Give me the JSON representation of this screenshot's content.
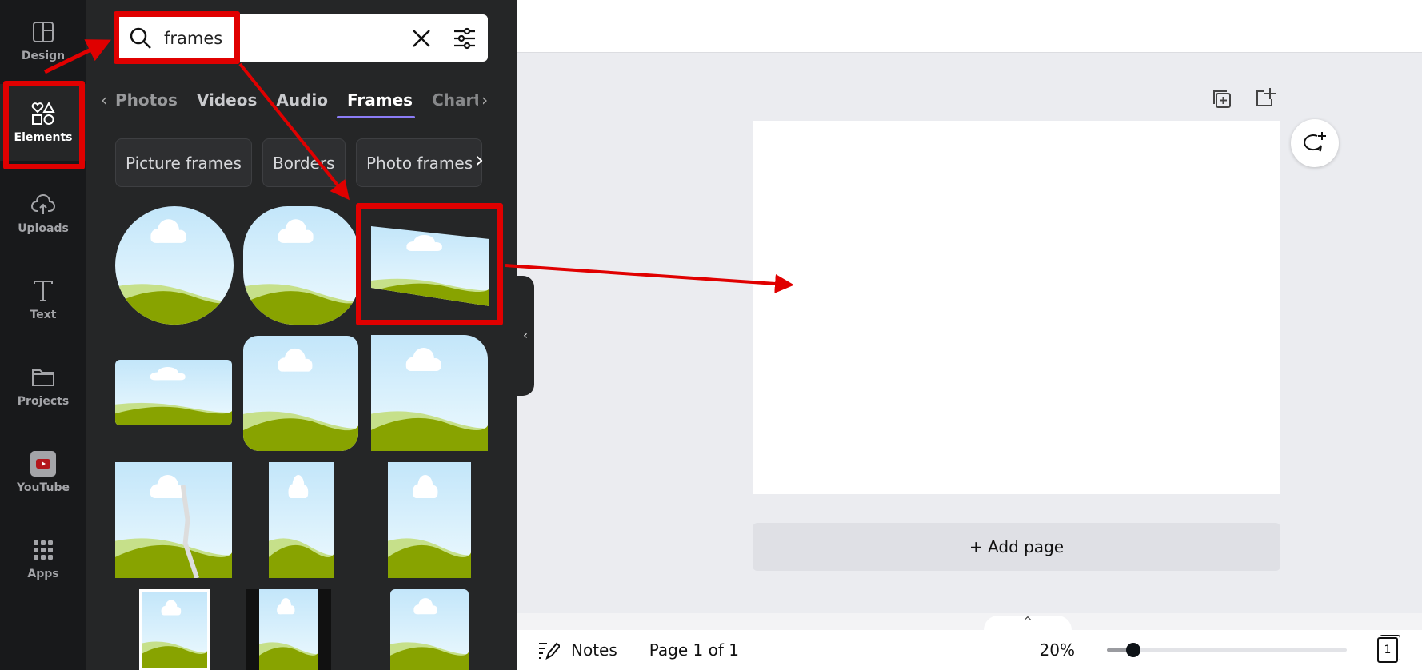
{
  "sidebar": {
    "items": [
      {
        "label": "Design",
        "icon": "layout-icon"
      },
      {
        "label": "Elements",
        "icon": "shapes-icon",
        "active": true
      },
      {
        "label": "Uploads",
        "icon": "cloud-upload-icon"
      },
      {
        "label": "Text",
        "icon": "text-icon"
      },
      {
        "label": "Projects",
        "icon": "folder-icon"
      },
      {
        "label": "YouTube",
        "icon": "youtube-icon"
      },
      {
        "label": "Apps",
        "icon": "apps-grid-icon"
      }
    ]
  },
  "search": {
    "value": "frames"
  },
  "tabs": [
    {
      "label": "Photos"
    },
    {
      "label": "Videos"
    },
    {
      "label": "Audio"
    },
    {
      "label": "Frames",
      "active": true
    },
    {
      "label": "Charts"
    }
  ],
  "chips": [
    {
      "label": "Picture frames"
    },
    {
      "label": "Borders"
    },
    {
      "label": "Photo frames"
    }
  ],
  "canvas": {
    "add_page": "+ Add page"
  },
  "bottom": {
    "notes": "Notes",
    "page_indicator": "Page 1 of 1",
    "zoom": "20%",
    "zoom_percent": 20,
    "page_count": "1"
  },
  "colors": {
    "accent": "#8b7cf6",
    "annotation": "#e00000",
    "sidebar_bg": "#18191b",
    "panel_bg": "#252627"
  }
}
